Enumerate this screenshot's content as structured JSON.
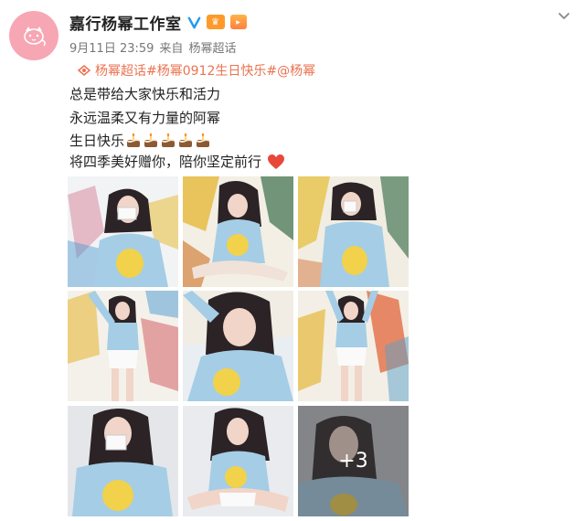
{
  "post": {
    "author": "嘉行杨幂工作室",
    "date": "9月11日 23:59",
    "source_prefix": "来自",
    "source": "杨幂超话",
    "topic_link": "杨幂超话#杨幂0912生日快乐#@杨幂",
    "lines": [
      "总是带给大家快乐和活力",
      "永远温柔又有力量的阿幂",
      "生日快乐",
      "将四季美好赠你，陪你坚定前行"
    ],
    "cake_count": 5,
    "more_photos": "+3",
    "colors": {
      "link": "#eb7350",
      "verified": "#1e9bf0",
      "avatar_bg": "#f7a6b4"
    },
    "icons": [
      "chevron-down-icon",
      "verified-icon",
      "topic-icon",
      "cake-icon",
      "heart-icon"
    ]
  }
}
